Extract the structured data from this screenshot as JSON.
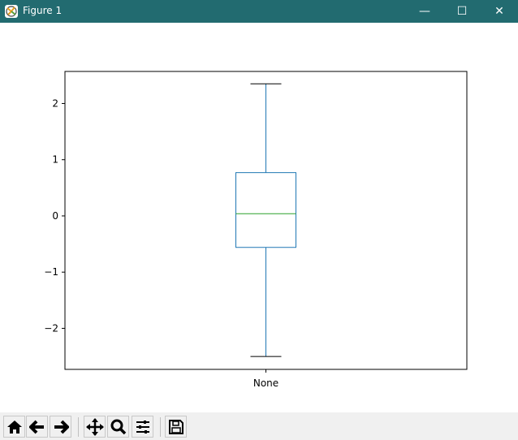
{
  "window": {
    "title": "Figure 1",
    "minimize": "—",
    "maximize": "☐",
    "close": "✕"
  },
  "toolbar": {
    "buttons": [
      "home-icon",
      "back-icon",
      "forward-icon",
      "pan-icon",
      "zoom-icon",
      "configure-subplots-icon",
      "save-icon"
    ]
  },
  "colors": {
    "titlebar": "#226b70",
    "box": "#1f77b4",
    "median": "#2ca02c",
    "caps": "#000000"
  },
  "chart_data": {
    "type": "box",
    "title": "",
    "xlabel": "",
    "ylabel": "",
    "categories": [
      "None"
    ],
    "boxes": [
      {
        "label": "None",
        "whisker_low": -2.5,
        "q1": -0.56,
        "median": 0.04,
        "q3": 0.77,
        "whisker_high": 2.35
      }
    ],
    "ylim": [
      -2.73,
      2.57
    ],
    "yticks": [
      -2,
      -1,
      0,
      1,
      2
    ],
    "ytick_labels": [
      "−2",
      "−1",
      "0",
      "1",
      "2"
    ],
    "grid": false
  }
}
